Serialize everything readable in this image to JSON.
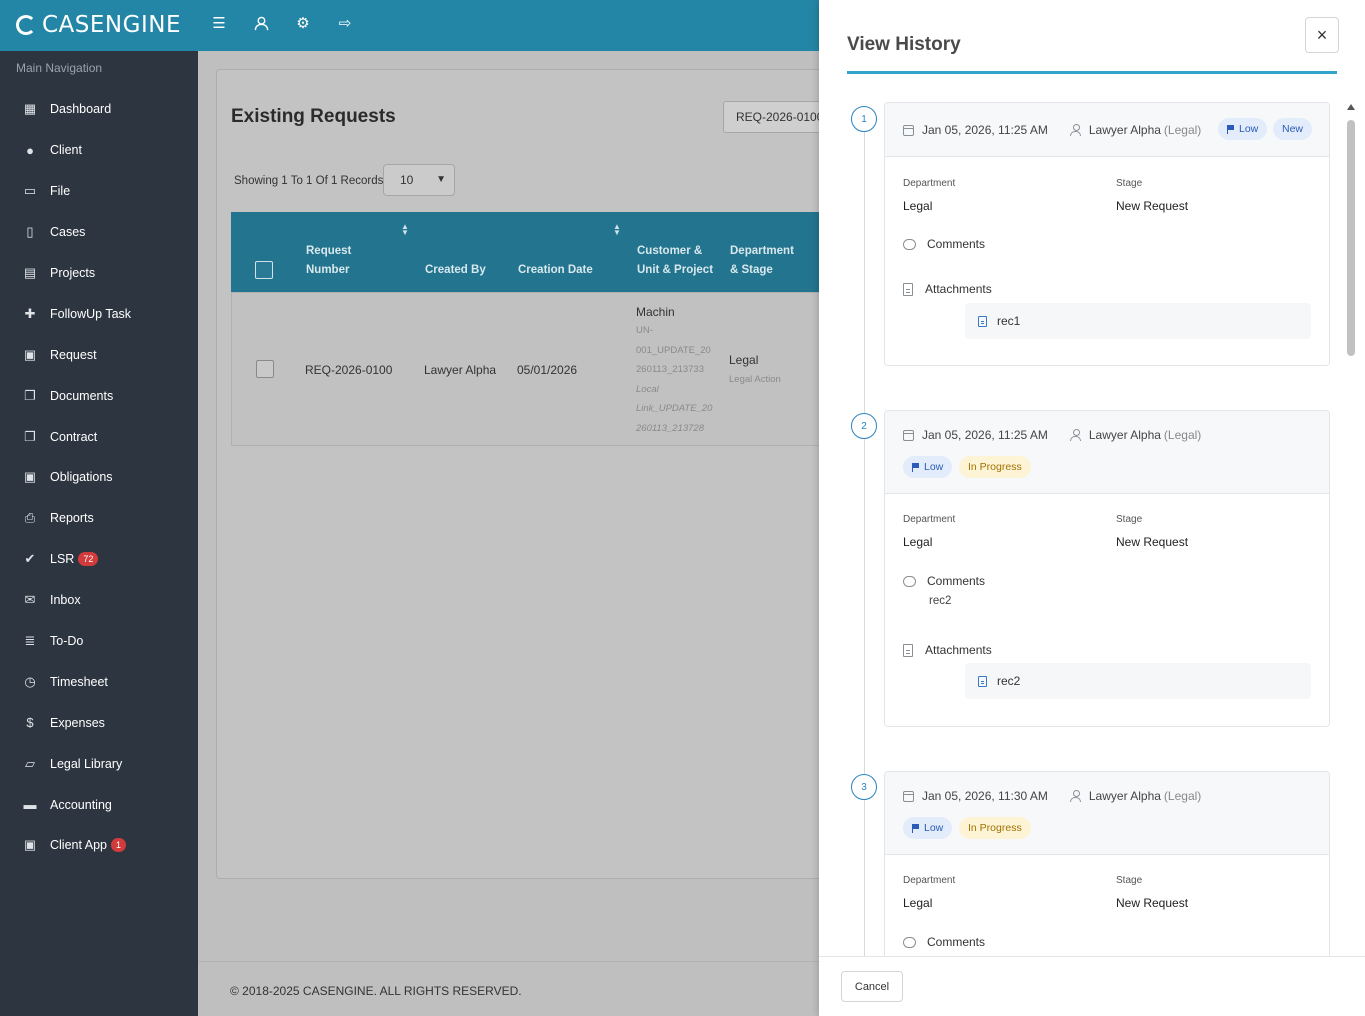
{
  "app": {
    "brand": "CASENGINE"
  },
  "topbar": {
    "icons": [
      "menu-icon",
      "user-icon",
      "settings-icon",
      "logout-icon"
    ]
  },
  "sidebar": {
    "heading": "Main Navigation",
    "items": [
      {
        "label": "Dashboard",
        "icon": "dashboard-icon"
      },
      {
        "label": "Client",
        "icon": "user-icon"
      },
      {
        "label": "File",
        "icon": "folder-icon"
      },
      {
        "label": "Cases",
        "icon": "file-icon"
      },
      {
        "label": "Projects",
        "icon": "projects-icon"
      },
      {
        "label": "FollowUp Task",
        "icon": "puzzle-icon"
      },
      {
        "label": "Request",
        "icon": "calendar-icon"
      },
      {
        "label": "Documents",
        "icon": "documents-icon"
      },
      {
        "label": "Contract",
        "icon": "contract-icon"
      },
      {
        "label": "Obligations",
        "icon": "calendar-icon"
      },
      {
        "label": "Reports",
        "icon": "print-icon"
      },
      {
        "label": "LSR",
        "icon": "check-icon",
        "badge": "72"
      },
      {
        "label": "Inbox",
        "icon": "envelope-icon"
      },
      {
        "label": "To-Do",
        "icon": "list-icon"
      },
      {
        "label": "Timesheet",
        "icon": "clock-icon"
      },
      {
        "label": "Expenses",
        "icon": "dollar-icon"
      },
      {
        "label": "Legal Library",
        "icon": "book-icon"
      },
      {
        "label": "Accounting",
        "icon": "card-icon"
      },
      {
        "label": "Client App",
        "icon": "id-card-icon",
        "badge": "1"
      }
    ]
  },
  "main": {
    "title": "Existing Requests",
    "search_value": "REQ-2026-0100",
    "showing": "Showing 1 To 1 Of 1 Records",
    "per_page": "10",
    "columns": [
      "Request Number",
      "Created By",
      "Creation Date",
      "Customer & Unit & Project",
      "Department & Stage"
    ],
    "column_lines": {
      "req1": "Request",
      "req2": "Number",
      "cust1": "Customer &",
      "cust2": "Unit & Project",
      "dept1": "Department",
      "dept2": "& Stage"
    },
    "row": {
      "request_number": "REQ-2026-0100",
      "created_by": "Lawyer Alpha",
      "creation_date": "05/01/2026",
      "customer": "Machin",
      "unit_lines": [
        "UN-",
        "001_UPDATE_20",
        "260113_213733"
      ],
      "project_lines": [
        "Local",
        "Link_UPDATE_20",
        "260113_213728"
      ],
      "department": "Legal",
      "stage": "Legal Action"
    },
    "footer": "© 2018-2025 CASENGINE. ALL RIGHTS RESERVED."
  },
  "history_panel": {
    "title": "View History",
    "close_label": "×",
    "cancel_label": "Cancel",
    "labels": {
      "department": "Department",
      "stage": "Stage",
      "comments": "Comments",
      "attachments": "Attachments"
    },
    "entries": [
      {
        "step": "1",
        "datetime": "Jan 05, 2026, 11:25 AM",
        "user": "Lawyer Alpha",
        "role": "(Legal)",
        "priority": "Low",
        "status": "New",
        "department": "Legal",
        "stage": "New Request",
        "comment": "",
        "attachment": "rec1"
      },
      {
        "step": "2",
        "datetime": "Jan 05, 2026, 11:25 AM",
        "user": "Lawyer Alpha",
        "role": "(Legal)",
        "priority": "Low",
        "status": "In Progress",
        "department": "Legal",
        "stage": "New Request",
        "comment": "rec2",
        "attachment": "rec2"
      },
      {
        "step": "3",
        "datetime": "Jan 05, 2026, 11:30 AM",
        "user": "Lawyer Alpha",
        "role": "(Legal)",
        "priority": "Low",
        "status": "In Progress",
        "department": "Legal",
        "stage": "New Request",
        "comment": "",
        "attachment": ""
      }
    ]
  }
}
